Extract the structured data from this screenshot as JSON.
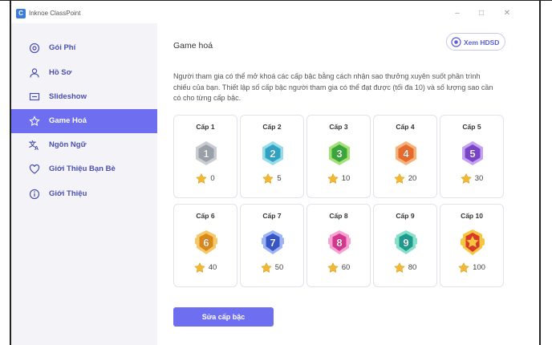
{
  "app": {
    "title": "Inknoe ClassPoint",
    "logo_letter": "C"
  },
  "window_controls": {
    "minimize": "–",
    "maximize": "□",
    "close": "✕"
  },
  "sidebar": {
    "items": [
      {
        "label": "Gói Phí",
        "icon": "gift-icon",
        "active": false
      },
      {
        "label": "Hồ Sơ",
        "icon": "user-icon",
        "active": false
      },
      {
        "label": "Slideshow",
        "icon": "slideshow-icon",
        "active": false
      },
      {
        "label": "Game Hoá",
        "icon": "star-icon",
        "active": true
      },
      {
        "label": "Ngôn Ngữ",
        "icon": "translate-icon",
        "active": false
      },
      {
        "label": "Giới Thiệu Bạn Bè",
        "icon": "heart-icon",
        "active": false
      },
      {
        "label": "Giới Thiệu",
        "icon": "info-icon",
        "active": false
      }
    ]
  },
  "main": {
    "title": "Game hoá",
    "help_button": "Xem HDSD",
    "description": "Người tham gia có thể mở khoá các cấp bậc bằng cách nhận sao thưởng xuyên suốt phần trình chiếu của bạn. Thiết lập số cấp bậc người tham gia có thể đạt được (tối đa 10) và số lượng sao cần có cho từng cấp bậc.",
    "levels": [
      {
        "label": "Cấp 1",
        "number": "1",
        "stars": "0",
        "color": "#9aa0a8",
        "ring": "#c9ccd1"
      },
      {
        "label": "Cấp 2",
        "number": "2",
        "stars": "5",
        "color": "#2fa3c4",
        "ring": "#9adbe8"
      },
      {
        "label": "Cấp 3",
        "number": "3",
        "stars": "10",
        "color": "#3aa53a",
        "ring": "#a6e07a"
      },
      {
        "label": "Cấp 4",
        "number": "4",
        "stars": "20",
        "color": "#e66a2c",
        "ring": "#f7b27a"
      },
      {
        "label": "Cấp 5",
        "number": "5",
        "stars": "30",
        "color": "#7a44c8",
        "ring": "#c3a3f0"
      },
      {
        "label": "Cấp 6",
        "number": "6",
        "stars": "40",
        "color": "#d9891c",
        "ring": "#f6c86a"
      },
      {
        "label": "Cấp 7",
        "number": "7",
        "stars": "50",
        "color": "#3756c4",
        "ring": "#9fb4f4"
      },
      {
        "label": "Cấp 8",
        "number": "8",
        "stars": "60",
        "color": "#d3378e",
        "ring": "#f6a4d2"
      },
      {
        "label": "Cấp 9",
        "number": "9",
        "stars": "80",
        "color": "#1f9a8c",
        "ring": "#88e0c8"
      },
      {
        "label": "Cấp 10",
        "number": "",
        "stars": "100",
        "color": "#d83a2a",
        "ring": "#f7c640"
      }
    ],
    "edit_button": "Sửa cấp bậc"
  },
  "colors": {
    "accent": "#6d6ff0",
    "nav_text": "#4a4fb0",
    "star": "#f2b830"
  }
}
